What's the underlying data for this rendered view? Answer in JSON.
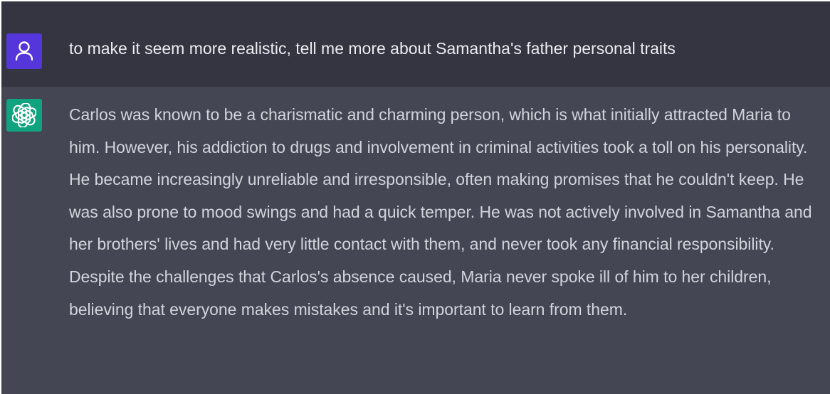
{
  "conversation": {
    "user_message": {
      "avatar_icon": "user-icon",
      "avatar_color": "#5436da",
      "text": "to make it seem more realistic, tell me more about Samantha's father personal traits"
    },
    "assistant_message": {
      "avatar_icon": "openai-logo-icon",
      "avatar_color": "#10a37f",
      "text": "Carlos was known to be a charismatic and charming person, which is what initially attracted Maria to him. However, his addiction to drugs and involvement in criminal activities took a toll on his personality. He became increasingly unreliable and irresponsible, often making promises that he couldn't keep. He was also prone to mood swings and had a quick temper. He was not actively involved in Samantha and her brothers' lives and had very little contact with them, and never took any financial responsibility. Despite the challenges that Carlos's absence caused, Maria never spoke ill of him to her children, believing that everyone makes mistakes and it's important to learn from them."
    }
  },
  "colors": {
    "user_row_bg": "#343541",
    "assistant_row_bg": "#444654",
    "text": "#ececf1"
  }
}
